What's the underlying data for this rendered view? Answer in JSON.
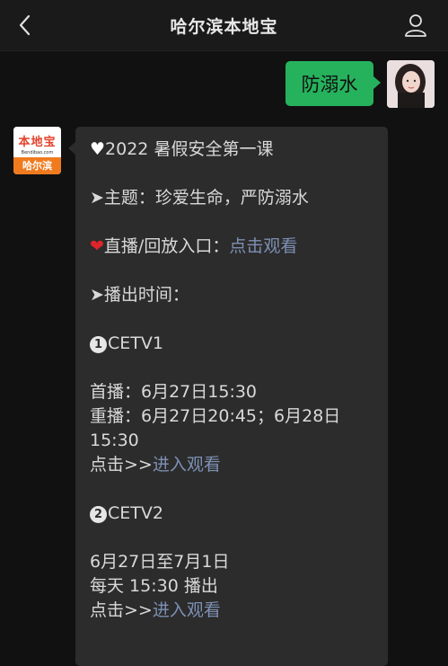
{
  "header": {
    "title": "哈尔滨本地宝",
    "back_icon": "chevron-left-icon",
    "profile_icon": "person-icon"
  },
  "outgoing": {
    "text": "防溺水"
  },
  "bot": {
    "logo_text": "本地宝",
    "logo_url": "Bendibao.com",
    "city": "哈尔滨"
  },
  "message": {
    "title": "2022 暑假安全第一课",
    "topic_prefix": "➤主题：",
    "topic": "珍爱生命，严防溺水",
    "live_label": "直播/回放入口：",
    "live_link": "点击观看",
    "schedule_label": "➤播出时间：",
    "channel1": {
      "number": "1",
      "name": "CETV1",
      "first": "首播：6月27日15:30",
      "rerun": "重播：6月27日20:45；6月28日",
      "rerun2": "15:30",
      "click_prefix": "点击>>",
      "link": "进入观看"
    },
    "channel2": {
      "number": "2",
      "name": "CETV2",
      "dates": "6月27日至7月1日",
      "daily": "每天 15:30 播出",
      "click_prefix": "点击>>",
      "link": "进入观看"
    }
  },
  "colors": {
    "header_bg": "#1a1a1a",
    "page_bg": "#111111",
    "outgoing_bubble": "#26b25d",
    "incoming_bubble": "#2c2c2c",
    "link": "#7d90b4",
    "red_heart": "#e0242b"
  }
}
